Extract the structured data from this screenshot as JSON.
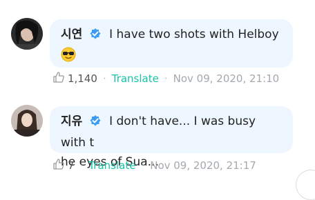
{
  "comments": [
    {
      "author": "시연",
      "text_line1": "I have two shots with Helboy",
      "text_line2": "",
      "like_count": "1,140",
      "translate_label": "Translate",
      "date": "Nov 09, 2020, 21:10"
    },
    {
      "author": "지유",
      "text_line1": "I don't have... I was busy with t",
      "text_line2": "he eyes of Sua...",
      "like_count": "7",
      "translate_label": "Translate",
      "date": "Nov 09, 2020, 21:17"
    }
  ],
  "colors": {
    "bubble": "#eef7ff",
    "translate": "#17c3a8",
    "verified": "#3b9cf5"
  },
  "icons": [
    "avatar",
    "verified-badge-icon",
    "sunglasses-emoji-icon",
    "like-icon"
  ]
}
